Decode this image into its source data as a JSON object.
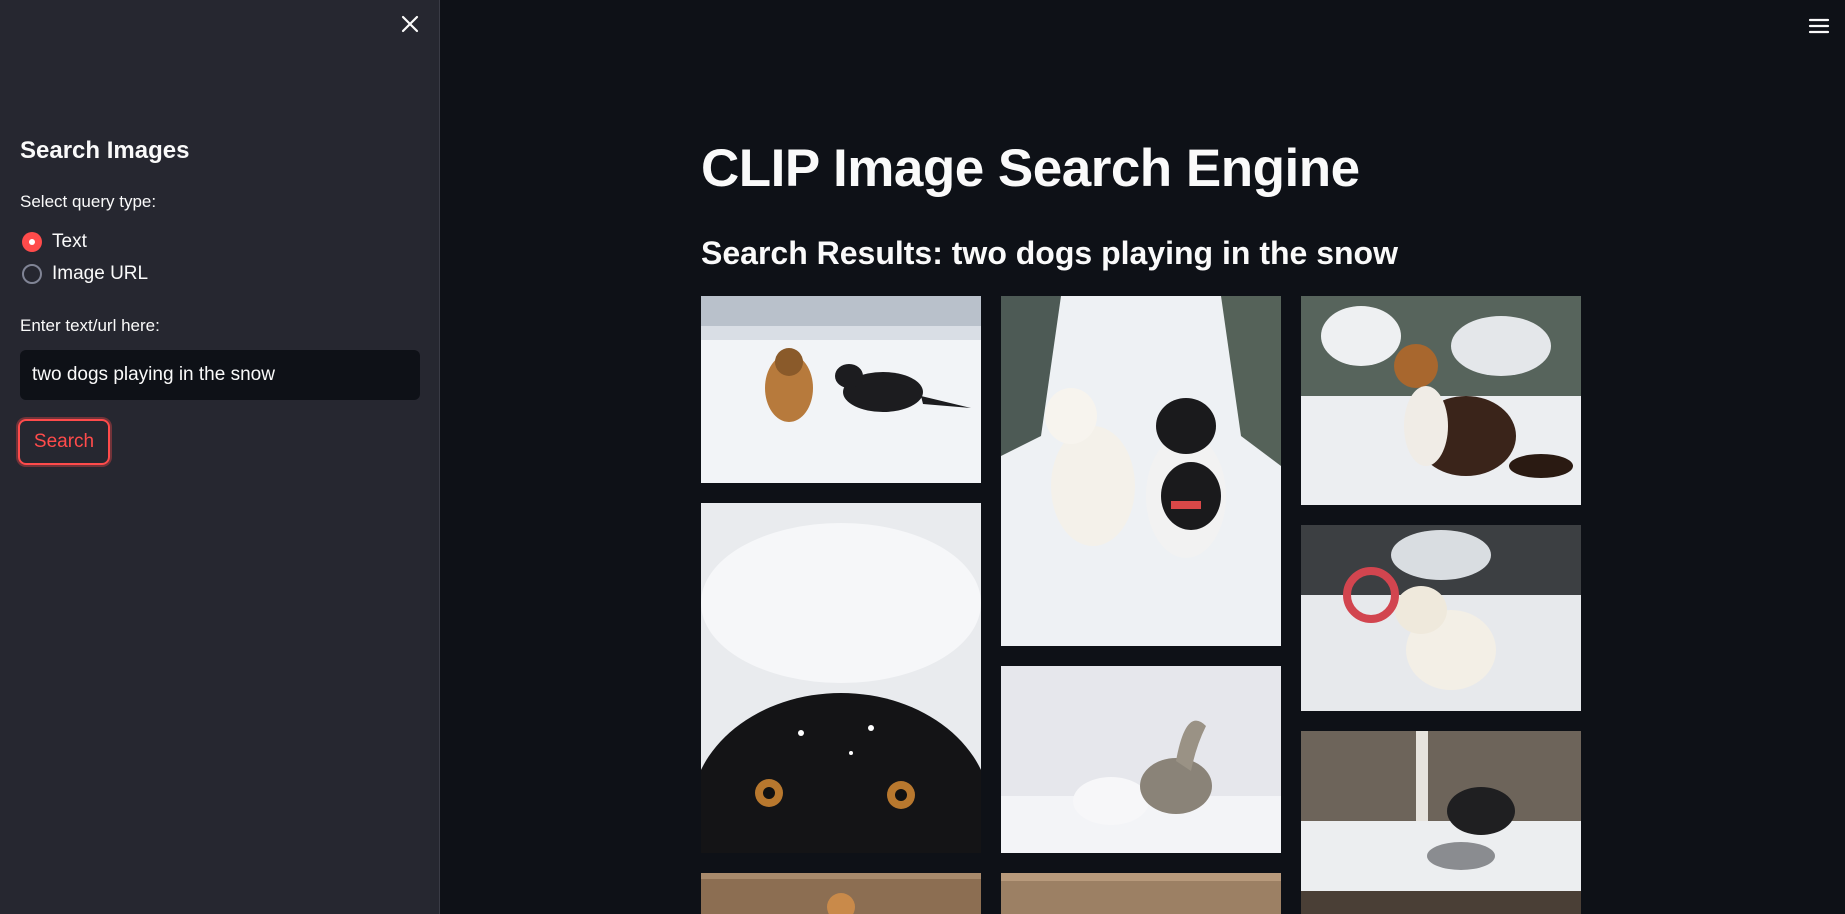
{
  "sidebar": {
    "title": "Search Images",
    "query_type_label": "Select query type:",
    "query_options": [
      {
        "label": "Text",
        "selected": true
      },
      {
        "label": "Image URL",
        "selected": false
      }
    ],
    "input_label": "Enter text/url here:",
    "input_value": "two dogs playing in the snow",
    "search_button": "Search"
  },
  "main": {
    "title": "CLIP Image Search Engine",
    "results_heading": "Search Results: two dogs playing in the snow"
  },
  "colors": {
    "accent": "#ff4b4b",
    "background": "#0e1117",
    "sidebar_background": "#262730"
  },
  "icons": {
    "close": "close-icon",
    "menu": "hamburger-menu-icon"
  }
}
